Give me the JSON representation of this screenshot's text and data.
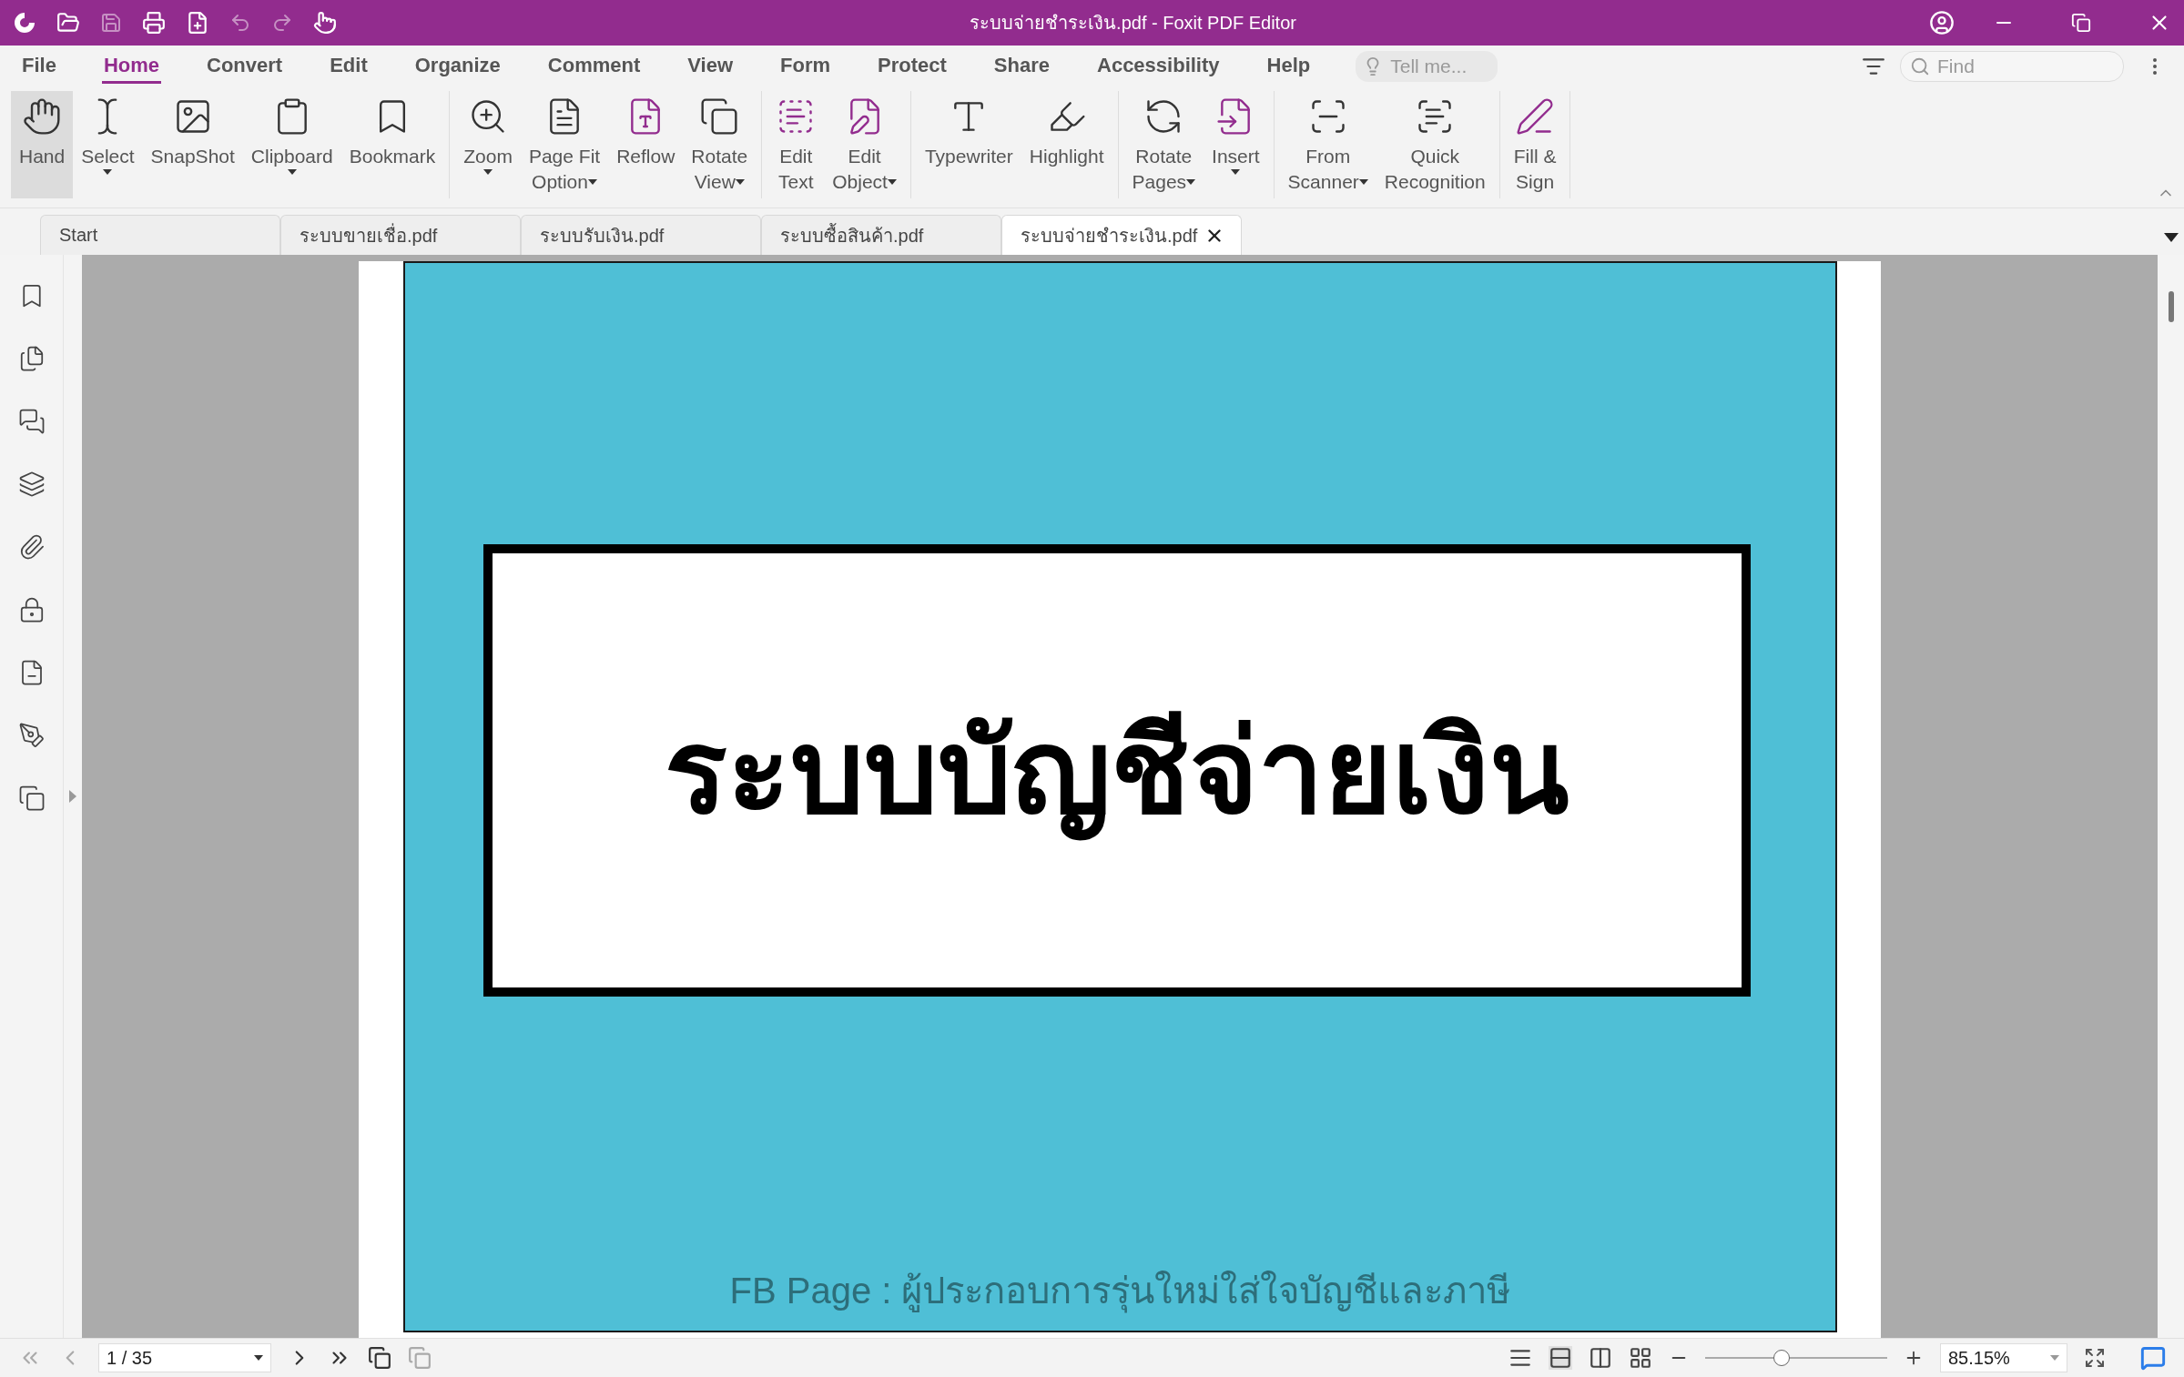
{
  "window": {
    "title": "ระบบจ่ายชำระเงิน.pdf - Foxit PDF Editor"
  },
  "menu": {
    "tabs": [
      {
        "label": "File",
        "selected": false
      },
      {
        "label": "Home",
        "selected": true
      },
      {
        "label": "Convert",
        "selected": false
      },
      {
        "label": "Edit",
        "selected": false
      },
      {
        "label": "Organize",
        "selected": false
      },
      {
        "label": "Comment",
        "selected": false
      },
      {
        "label": "View",
        "selected": false
      },
      {
        "label": "Form",
        "selected": false
      },
      {
        "label": "Protect",
        "selected": false
      },
      {
        "label": "Share",
        "selected": false
      },
      {
        "label": "Accessibility",
        "selected": false
      },
      {
        "label": "Help",
        "selected": false
      }
    ],
    "tell_me": {
      "placeholder": "Tell me..."
    },
    "find": {
      "placeholder": "Find"
    }
  },
  "ribbon": {
    "groups": [
      {
        "items": [
          {
            "lines": [
              "Hand"
            ],
            "menu": false,
            "selected": true
          },
          {
            "lines": [
              "Select"
            ],
            "menu": true,
            "selected": false
          },
          {
            "lines": [
              "SnapShot"
            ],
            "menu": false,
            "selected": false
          },
          {
            "lines": [
              "Clipboard"
            ],
            "menu": true,
            "selected": false
          },
          {
            "lines": [
              "Bookmark"
            ],
            "menu": false,
            "selected": false
          }
        ]
      },
      {
        "items": [
          {
            "lines": [
              "Zoom"
            ],
            "menu": true,
            "selected": false
          },
          {
            "lines": [
              "Page Fit",
              "Option"
            ],
            "menu": true,
            "selected": false
          },
          {
            "lines": [
              "Reflow"
            ],
            "menu": false,
            "selected": false
          },
          {
            "lines": [
              "Rotate",
              "View"
            ],
            "menu": true,
            "selected": false
          }
        ]
      },
      {
        "items": [
          {
            "lines": [
              "Edit",
              "Text"
            ],
            "menu": false,
            "selected": false
          },
          {
            "lines": [
              "Edit",
              "Object"
            ],
            "menu": true,
            "selected": false
          }
        ]
      },
      {
        "items": [
          {
            "lines": [
              "Typewriter"
            ],
            "menu": false,
            "selected": false
          },
          {
            "lines": [
              "Highlight"
            ],
            "menu": false,
            "selected": false
          }
        ]
      },
      {
        "items": [
          {
            "lines": [
              "Rotate",
              "Pages"
            ],
            "menu": true,
            "selected": false
          },
          {
            "lines": [
              "Insert"
            ],
            "menu": true,
            "selected": false
          }
        ]
      },
      {
        "items": [
          {
            "lines": [
              "From",
              "Scanner"
            ],
            "menu": true,
            "selected": false
          },
          {
            "lines": [
              "Quick",
              "Recognition"
            ],
            "menu": false,
            "selected": false
          }
        ]
      },
      {
        "items": [
          {
            "lines": [
              "Fill &",
              "Sign"
            ],
            "menu": false,
            "selected": false
          }
        ]
      }
    ]
  },
  "doc_tabs": [
    {
      "label": "Start",
      "selected": false
    },
    {
      "label": "ระบบขายเชื่อ.pdf",
      "selected": false
    },
    {
      "label": "ระบบรับเงิน.pdf",
      "selected": false
    },
    {
      "label": "ระบบซื้อสินค้า.pdf",
      "selected": false
    },
    {
      "label": "ระบบจ่ายชำระเงิน.pdf",
      "selected": true
    }
  ],
  "document": {
    "heading": "ระบบบัญชีจ่ายเงิน",
    "footer": "FB Page : ผู้ประกอบการรุ่นใหม่ใส่ใจบัญชีและภาษี"
  },
  "status_bar": {
    "page": "1 / 35",
    "zoom": "85.15%",
    "zoom_slider": {
      "level": 0.42
    }
  }
}
